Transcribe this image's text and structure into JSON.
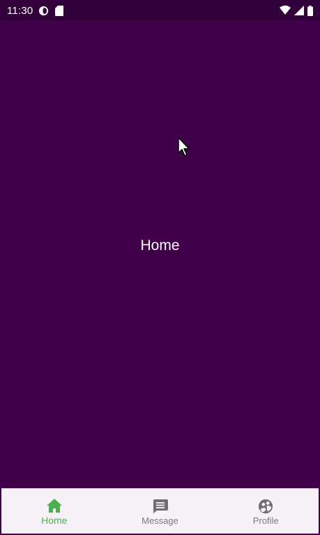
{
  "status_bar": {
    "time": "11:30",
    "left_icons": [
      "data-saver-icon",
      "sd-card-icon"
    ],
    "right_icons": [
      "wifi-icon",
      "cellular-signal-icon",
      "battery-icon"
    ]
  },
  "main": {
    "title": "Home"
  },
  "bottom_nav": {
    "items": [
      {
        "label": "Home",
        "icon": "home-icon",
        "active": true
      },
      {
        "label": "Message",
        "icon": "message-icon",
        "active": false
      },
      {
        "label": "Profile",
        "icon": "profile-icon",
        "active": false
      }
    ]
  },
  "colors": {
    "background": "#410049",
    "status_bar": "#32003a",
    "nav_background": "#f7f2f8",
    "active": "#4caf50",
    "inactive": "#7a7a7a"
  }
}
